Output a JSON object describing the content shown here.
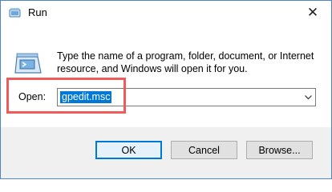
{
  "window": {
    "title": "Run"
  },
  "titlebar": {
    "close_glyph": "✕",
    "icon": "run-app-icon"
  },
  "dialog": {
    "icon": "run-dialog-icon",
    "description": "Type the name of a program, folder, document, or Internet resource, and Windows will open it for you.",
    "open_label": "Open:",
    "open_value": "gpedit.msc"
  },
  "buttons": {
    "ok": "OK",
    "cancel": "Cancel",
    "browse": "Browse..."
  },
  "colors": {
    "selection": "#0078d7",
    "highlight_box": "#ef5b5b",
    "footer_bg": "#f0f0f0"
  }
}
